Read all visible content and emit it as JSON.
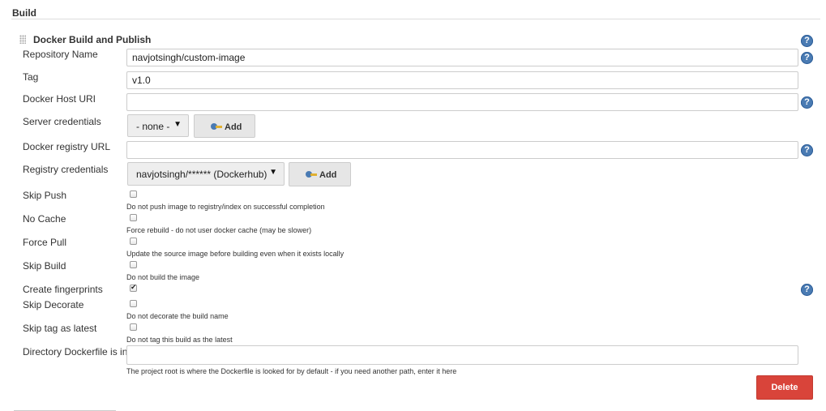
{
  "section": {
    "title": "Build"
  },
  "block": {
    "title": "Docker Build and Publish"
  },
  "fields": {
    "repository_name": {
      "label": "Repository Name",
      "value": "navjotsingh/custom-image"
    },
    "tag": {
      "label": "Tag",
      "value": "v1.0"
    },
    "docker_host_uri": {
      "label": "Docker Host URI",
      "value": ""
    },
    "server_credentials": {
      "label": "Server credentials",
      "selected": "- none -",
      "add_label": "Add"
    },
    "docker_registry_url": {
      "label": "Docker registry URL",
      "value": ""
    },
    "registry_credentials": {
      "label": "Registry credentials",
      "selected": "navjotsingh/****** (Dockerhub)",
      "add_label": "Add"
    },
    "dockerfile_dir": {
      "label": "Directory Dockerfile is in",
      "value": "",
      "description": "The project root is where the Dockerfile is looked for by default - if you need another path, enter it here"
    }
  },
  "checkboxes": {
    "skip_push": {
      "label": "Skip Push",
      "checked": false,
      "description": "Do not push image to registry/index on successful completion"
    },
    "no_cache": {
      "label": "No Cache",
      "checked": false,
      "description": "Force rebuild - do not user docker cache (may be slower)"
    },
    "force_pull": {
      "label": "Force Pull",
      "checked": false,
      "description": "Update the source image before building even when it exists locally"
    },
    "skip_build": {
      "label": "Skip Build",
      "checked": false,
      "description": "Do not build the image"
    },
    "create_fingerprints": {
      "label": "Create fingerprints",
      "checked": true
    },
    "skip_decorate": {
      "label": "Skip Decorate",
      "checked": false,
      "description": "Do not decorate the build name"
    },
    "skip_tag_latest": {
      "label": "Skip tag as latest",
      "checked": false,
      "description": "Do not tag this build as the latest"
    }
  },
  "help_icon": {
    "glyph": "?"
  },
  "actions": {
    "delete_label": "Delete"
  },
  "colors": {
    "delete": "#d9443a",
    "help": "#4a7bb3"
  }
}
